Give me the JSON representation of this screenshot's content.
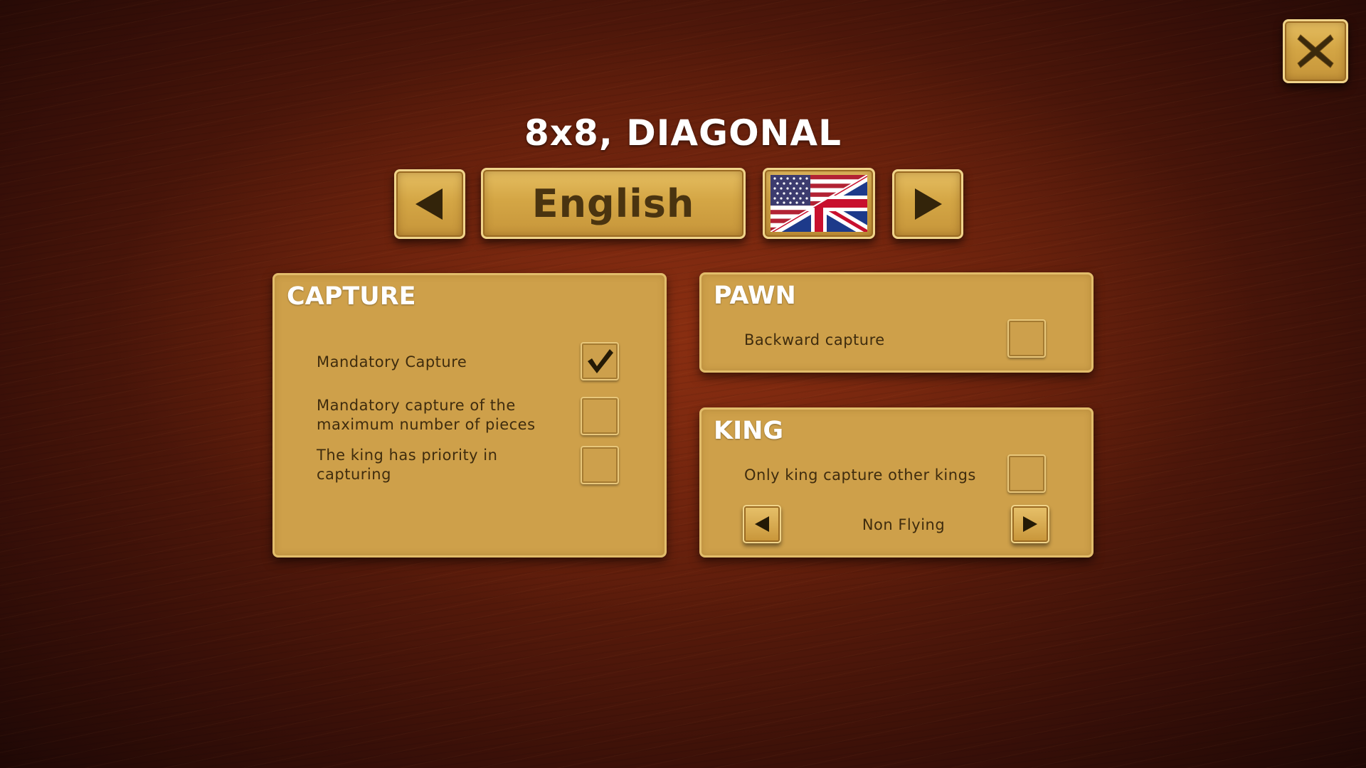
{
  "title": "8x8, DIAGONAL",
  "language": {
    "label": "English",
    "flag": "us-uk-flag-icon"
  },
  "capture": {
    "heading": "CAPTURE",
    "options": [
      {
        "label_line1": "Mandatory Capture",
        "label_line2": "",
        "checked": true
      },
      {
        "label_line1": "Mandatory capture of the",
        "label_line2": "maximum number of pieces",
        "checked": false
      },
      {
        "label_line1": "The king has priority in",
        "label_line2": "capturing",
        "checked": false
      }
    ]
  },
  "pawn": {
    "heading": "PAWN",
    "options": [
      {
        "label": "Backward capture",
        "checked": false
      }
    ]
  },
  "king": {
    "heading": "KING",
    "options": [
      {
        "label": "Only king capture other kings",
        "checked": false
      }
    ],
    "mode": "Non Flying"
  },
  "icons": {
    "close": "close-x-icon",
    "prev": "arrow-left-icon",
    "next": "arrow-right-icon",
    "check": "checkmark-icon"
  },
  "colors": {
    "gold": "#d4a645",
    "panel": "#cea04a",
    "dark_text": "#3f2c0e",
    "background": "#5c1c0b"
  }
}
